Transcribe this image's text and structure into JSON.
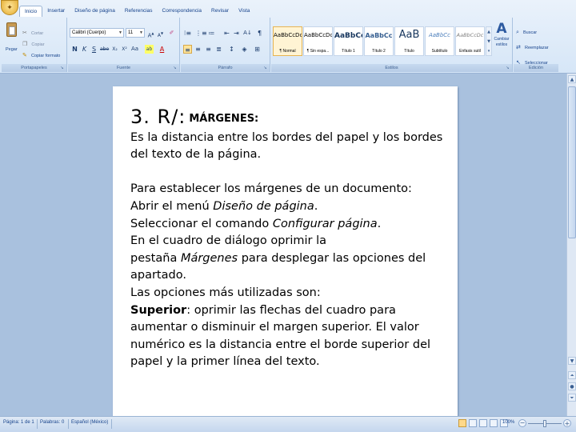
{
  "ribbon": {
    "office_button_glyph": "✦",
    "tabs": [
      "Inicio",
      "Insertar",
      "Diseño de página",
      "Referencias",
      "Correspondencia",
      "Revisar",
      "Vista"
    ],
    "active_tab": "Inicio",
    "clipboard": {
      "paste_label": "Pegar",
      "cut_label": "Cortar",
      "copy_label": "Copiar",
      "format_painter_label": "Copiar formato",
      "group_label": "Portapapeles"
    },
    "font": {
      "font_name": "Calibri (Cuerpo)",
      "font_size": "11",
      "group_label": "Fuente"
    },
    "paragraph": {
      "group_label": "Párrafo"
    },
    "styles": {
      "items": [
        {
          "sample": "AaBbCcDc",
          "name": "¶ Normal"
        },
        {
          "sample": "AaBbCcDc",
          "name": "¶ Sin espa..."
        },
        {
          "sample": "AaBbCc",
          "name": "Título 1"
        },
        {
          "sample": "AaBbCc",
          "name": "Título 2"
        },
        {
          "sample": "AaB",
          "name": "Título"
        },
        {
          "sample": "AaBbCc",
          "name": "Subtítulo"
        },
        {
          "sample": "AaBbCcDc",
          "name": "Énfasis sutil"
        }
      ],
      "change_styles_label": "Cambiar estilos",
      "group_label": "Estilos"
    },
    "editing": {
      "find_label": "Buscar",
      "replace_label": "Reemplazar",
      "select_label": "Seleccionar",
      "group_label": "Edición"
    }
  },
  "document": {
    "heading_number": "3. R/:",
    "heading_word": "MÁRGENES:",
    "definition_line1": "Es la distancia entre los bordes del papel y los bordes",
    "definition_line2": "del texto de la página.",
    "intro": "Para establecer los márgenes de un documento:",
    "step1_prefix": "Abrir el menú ",
    "step1_italic": "Diseño de página",
    "step1_suffix": ".",
    "step2_prefix": "Seleccionar el comando ",
    "step2_italic": "Configurar página",
    "step2_suffix": ".",
    "step3": "En el cuadro de diálogo oprimir la",
    "step4_prefix": "pestaña ",
    "step4_italic": "Márgenes",
    "step4_suffix": " para desplegar las opciones del",
    "step5": "apartado.",
    "options_intro": "Las opciones más utilizadas son:",
    "superior_bold": "Superior",
    "superior_line1": ": oprimir las flechas del cuadro para",
    "superior_line2": "aumentar o disminuir el margen superior. El valor",
    "superior_line3": "numérico es la distancia entre el borde superior del",
    "superior_line4": "papel y la primer línea del texto."
  },
  "statusbar": {
    "page": "Página: 1 de 1",
    "words": "Palabras: 0",
    "language": "Español (México)",
    "zoom": "100%"
  },
  "colors": {
    "ribbon_text": "#15428b",
    "doc_background": "#a9c1de",
    "selected_style": "#fff4d4"
  }
}
